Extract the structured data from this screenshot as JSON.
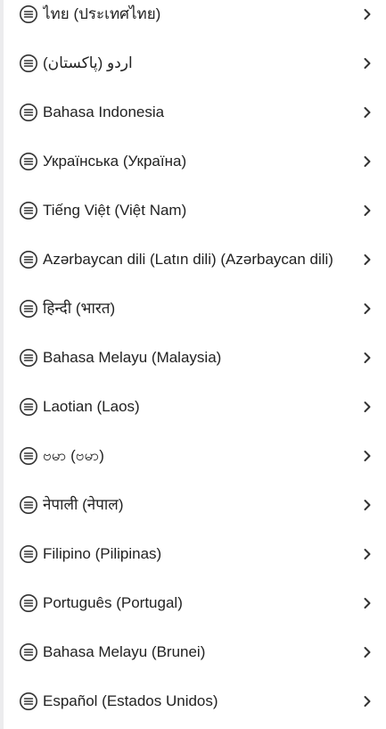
{
  "languages": [
    {
      "label": "ไทย (ประเทศไทย)",
      "icon": "list-lines-icon",
      "chevron": "chevron-right-icon"
    },
    {
      "label": "اردو (پاکستان)",
      "icon": "list-lines-icon",
      "chevron": "chevron-right-icon"
    },
    {
      "label": "Bahasa Indonesia",
      "icon": "list-lines-icon",
      "chevron": "chevron-right-icon"
    },
    {
      "label": "Українська (Україна)",
      "icon": "list-lines-icon",
      "chevron": "chevron-right-icon"
    },
    {
      "label": "Tiếng Việt (Việt Nam)",
      "icon": "list-lines-icon",
      "chevron": "chevron-right-icon"
    },
    {
      "label": "Azərbaycan dili (Latın dili) (Azərbaycan dili)",
      "icon": "list-lines-icon",
      "chevron": "chevron-right-icon"
    },
    {
      "label": "हिन्दी (भारत)",
      "icon": "list-lines-icon",
      "chevron": "chevron-right-icon"
    },
    {
      "label": "Bahasa Melayu (Malaysia)",
      "icon": "list-lines-icon",
      "chevron": "chevron-right-icon"
    },
    {
      "label": "Laotian (Laos)",
      "icon": "list-lines-icon",
      "chevron": "chevron-right-icon"
    },
    {
      "label": "ဗမာ (ဗမာ)",
      "icon": "list-lines-icon",
      "chevron": "chevron-right-icon"
    },
    {
      "label": "नेपाली (नेपाल)",
      "icon": "list-lines-icon",
      "chevron": "chevron-right-icon"
    },
    {
      "label": "Filipino (Pilipinas)",
      "icon": "list-lines-icon",
      "chevron": "chevron-right-icon"
    },
    {
      "label": "Português (Portugal)",
      "icon": "list-lines-icon",
      "chevron": "chevron-right-icon"
    },
    {
      "label": "Bahasa Melayu (Brunei)",
      "icon": "list-lines-icon",
      "chevron": "chevron-right-icon"
    },
    {
      "label": "Español (Estados Unidos)",
      "icon": "list-lines-icon",
      "chevron": "chevron-right-icon"
    }
  ],
  "colors": {
    "text": "#222222",
    "icon": "#333333",
    "background": "#ffffff",
    "left_rule": "#ececee"
  }
}
